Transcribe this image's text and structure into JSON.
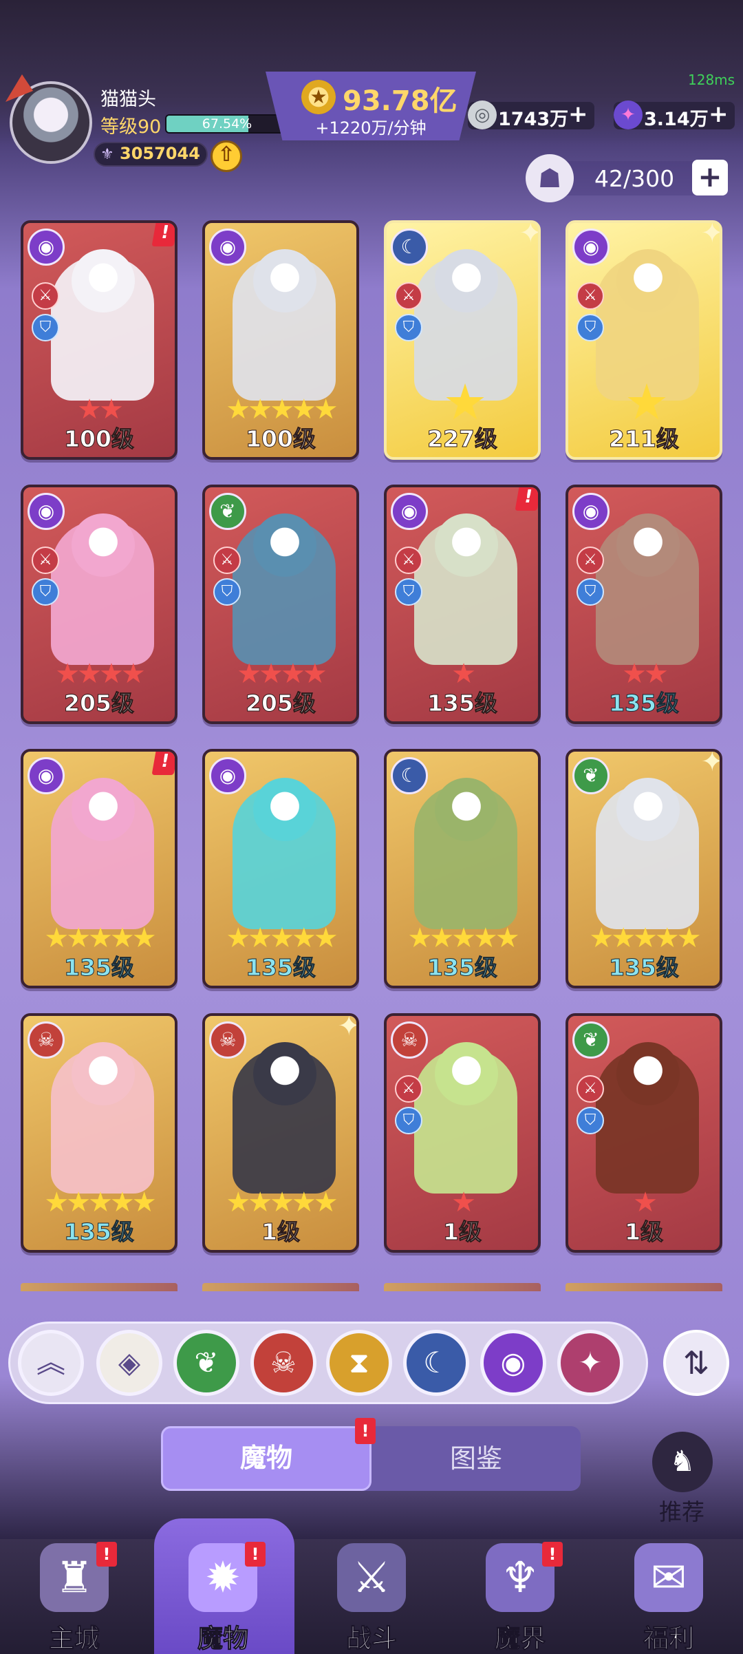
{
  "player": {
    "name": "猫猫头",
    "level": "等级90",
    "xp_percent_text": "67.54%",
    "xp_fraction": 0.6754,
    "power": "3057044"
  },
  "gold": {
    "value": "93.78亿",
    "rate": "+1220万/分钟"
  },
  "ping": "128ms",
  "currencies": [
    {
      "value": "1743万",
      "icon": "silver-coin-icon"
    },
    {
      "value": "3.14万",
      "icon": "crystal-star-icon"
    }
  ],
  "monster_count": "42/300",
  "cards": [
    {
      "level": "100级",
      "stars": 2,
      "star_color": "red",
      "element": "purple",
      "bg": "red",
      "alert": true
    },
    {
      "level": "100级",
      "stars": 5,
      "star_color": "gold",
      "element": "purple",
      "bg": "gold",
      "alert": false
    },
    {
      "level": "227级",
      "stars": 1,
      "star_color": "big",
      "element": "blue",
      "bg": "yellow",
      "alert": false
    },
    {
      "level": "211级",
      "stars": 1,
      "star_color": "big",
      "element": "purple",
      "bg": "yellow",
      "alert": false
    },
    {
      "level": "205级",
      "stars": 4,
      "star_color": "red",
      "element": "purple",
      "bg": "red",
      "alert": false
    },
    {
      "level": "205级",
      "stars": 4,
      "star_color": "red",
      "element": "green",
      "bg": "red",
      "alert": false
    },
    {
      "level": "135级",
      "stars": 1,
      "star_color": "red",
      "element": "purple",
      "bg": "red",
      "alert": true
    },
    {
      "level": "135级",
      "stars": 2,
      "star_color": "red",
      "element": "purple",
      "bg": "red",
      "alert": false
    },
    {
      "level": "135级",
      "stars": 5,
      "star_color": "gold",
      "element": "purple",
      "bg": "gold",
      "alert": true
    },
    {
      "level": "135级",
      "stars": 5,
      "star_color": "gold",
      "element": "purple",
      "bg": "gold",
      "alert": false
    },
    {
      "level": "135级",
      "stars": 5,
      "star_color": "gold",
      "element": "blue",
      "bg": "gold",
      "alert": false
    },
    {
      "level": "135级",
      "stars": 5,
      "star_color": "gold",
      "element": "green",
      "bg": "gold",
      "alert": false
    },
    {
      "level": "135级",
      "stars": 5,
      "star_color": "gold",
      "element": "red",
      "bg": "gold",
      "alert": false
    },
    {
      "level": "1级",
      "stars": 5,
      "star_color": "gold",
      "element": "red",
      "bg": "gold",
      "alert": false
    },
    {
      "level": "1级",
      "stars": 1,
      "star_color": "red",
      "element": "red",
      "bg": "red",
      "alert": false
    },
    {
      "level": "1级",
      "stars": 1,
      "star_color": "red",
      "element": "green",
      "bg": "red",
      "alert": false
    }
  ],
  "filters": [
    {
      "name": "collapse-icon",
      "glyph": "︽",
      "color": "#e9e5f3"
    },
    {
      "name": "all-elements-icon",
      "glyph": "◈",
      "color": "#f0ece6"
    },
    {
      "name": "nature-element-icon",
      "glyph": "❦",
      "color": "#3e9a49"
    },
    {
      "name": "demon-element-icon",
      "glyph": "☠",
      "color": "#c2413a"
    },
    {
      "name": "time-element-icon",
      "glyph": "⧗",
      "color": "#d8a02c"
    },
    {
      "name": "beast-element-icon",
      "glyph": "☾",
      "color": "#3a5ba8"
    },
    {
      "name": "eye-element-icon",
      "glyph": "◉",
      "color": "#7d3dc8"
    },
    {
      "name": "vortex-element-icon",
      "glyph": "✦",
      "color": "#ae3f6e"
    }
  ],
  "tabs": {
    "monster": "魔物",
    "atlas": "图鉴"
  },
  "recommend": "推荐",
  "nav": [
    {
      "label": "主城",
      "icon": "castle-icon",
      "glyph": "♜",
      "alert": true
    },
    {
      "label": "魔物",
      "icon": "monster-flame-icon",
      "glyph": "✹",
      "alert": true
    },
    {
      "label": "战斗",
      "icon": "battle-shield-icon",
      "glyph": "⚔",
      "alert": false
    },
    {
      "label": "魔界",
      "icon": "demon-realm-icon",
      "glyph": "♆",
      "alert": true
    },
    {
      "label": "福利",
      "icon": "gift-chest-icon",
      "glyph": "✉",
      "alert": false
    }
  ]
}
